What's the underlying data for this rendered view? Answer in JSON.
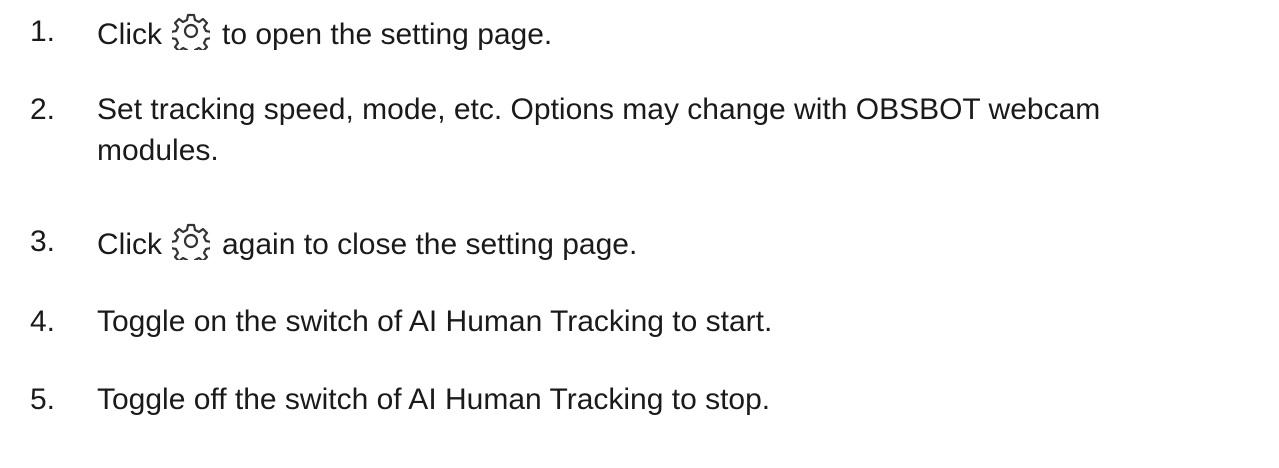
{
  "steps": [
    {
      "num": "1.",
      "before": "Click",
      "icon": "gear-icon",
      "after": "to open the setting page."
    },
    {
      "num": "2.",
      "line1": "Set tracking speed, mode, etc. Options may change with OBSBOT webcam",
      "line2": "modules."
    },
    {
      "num": "3.",
      "before": "Click",
      "icon": "gear-icon",
      "after": "again to close the setting page."
    },
    {
      "num": "4.",
      "text": "Toggle on the switch of AI Human Tracking to start."
    },
    {
      "num": "5.",
      "text": "Toggle off the switch of AI Human Tracking to stop."
    }
  ],
  "colors": {
    "text": "#1a1a1a",
    "icon": "#333333"
  }
}
